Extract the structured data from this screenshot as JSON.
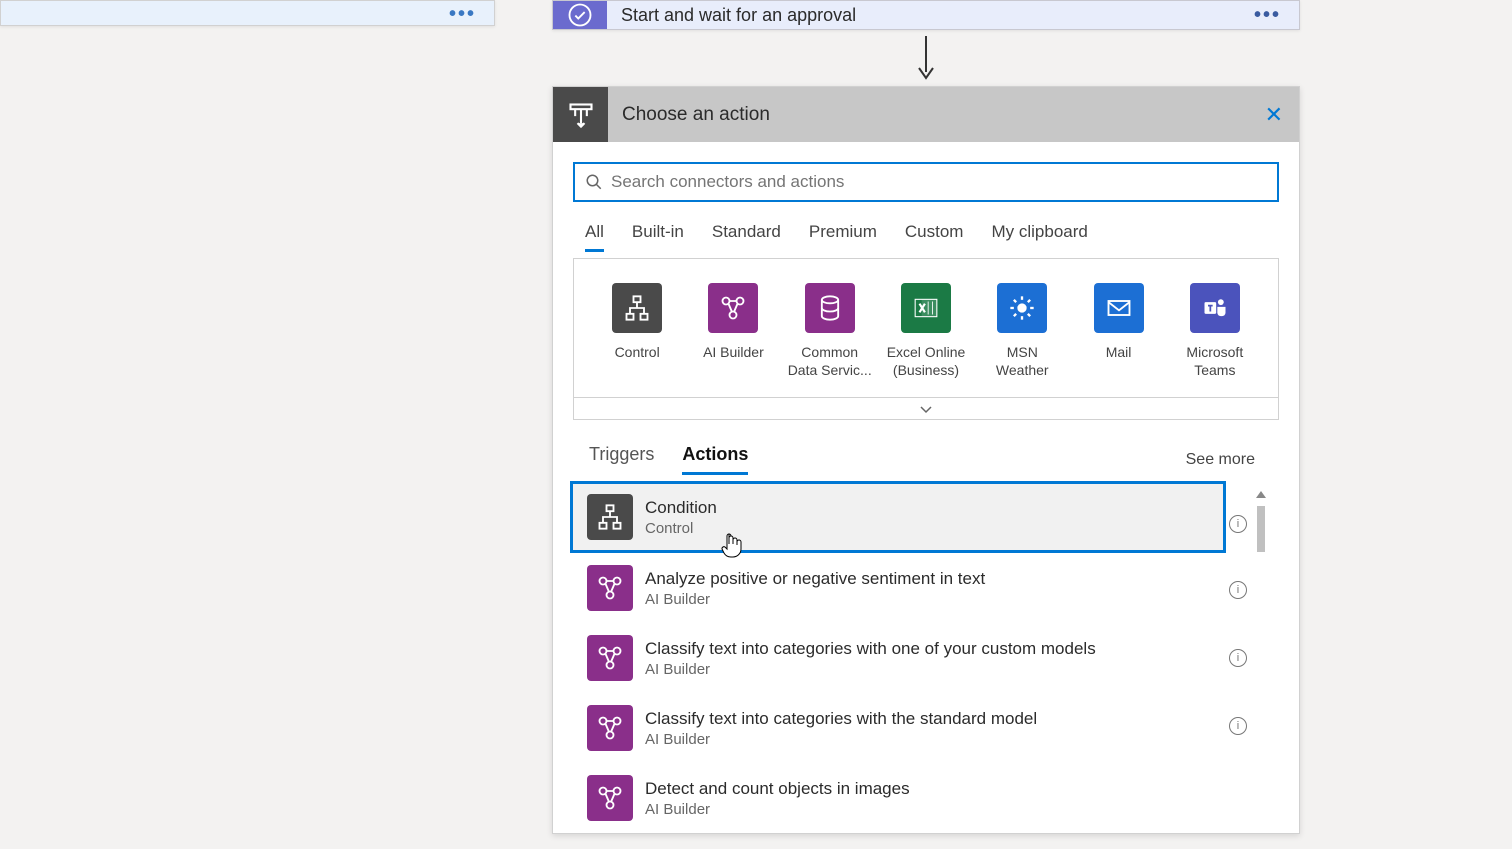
{
  "step": {
    "title": "Start and wait for an approval"
  },
  "panel": {
    "title": "Choose an action",
    "search_placeholder": "Search connectors and actions"
  },
  "catTabs": [
    "All",
    "Built-in",
    "Standard",
    "Premium",
    "Custom",
    "My clipboard"
  ],
  "activeCatTab": 0,
  "connectors": [
    {
      "label": "Control",
      "bg": "#4a4a4a",
      "svg": "control"
    },
    {
      "label": "AI Builder",
      "bg": "#8a2f8a",
      "svg": "ai"
    },
    {
      "label": "Common\nData Servic...",
      "bg": "#8a2f8a",
      "svg": "db"
    },
    {
      "label": "Excel Online\n(Business)",
      "bg": "#1b7a45",
      "svg": "excel"
    },
    {
      "label": "MSN\nWeather",
      "bg": "#1c6fd4",
      "svg": "sun"
    },
    {
      "label": "Mail",
      "bg": "#1c6fd4",
      "svg": "mail"
    },
    {
      "label": "Microsoft\nTeams",
      "bg": "#4b53bc",
      "svg": "teams"
    }
  ],
  "subTabs": [
    "Triggers",
    "Actions"
  ],
  "activeSubTab": 1,
  "seeMore": "See more",
  "actions": [
    {
      "title": "Condition",
      "subtitle": "Control",
      "bg": "#4a4a4a",
      "svg": "control",
      "highlighted": true
    },
    {
      "title": "Analyze positive or negative sentiment in text",
      "subtitle": "AI Builder",
      "bg": "#8a2f8a",
      "svg": "ai"
    },
    {
      "title": "Classify text into categories with one of your custom models",
      "subtitle": "AI Builder",
      "bg": "#8a2f8a",
      "svg": "ai"
    },
    {
      "title": "Classify text into categories with the standard model",
      "subtitle": "AI Builder",
      "bg": "#8a2f8a",
      "svg": "ai"
    },
    {
      "title": "Detect and count objects in images",
      "subtitle": "AI Builder",
      "bg": "#8a2f8a",
      "svg": "ai"
    }
  ]
}
